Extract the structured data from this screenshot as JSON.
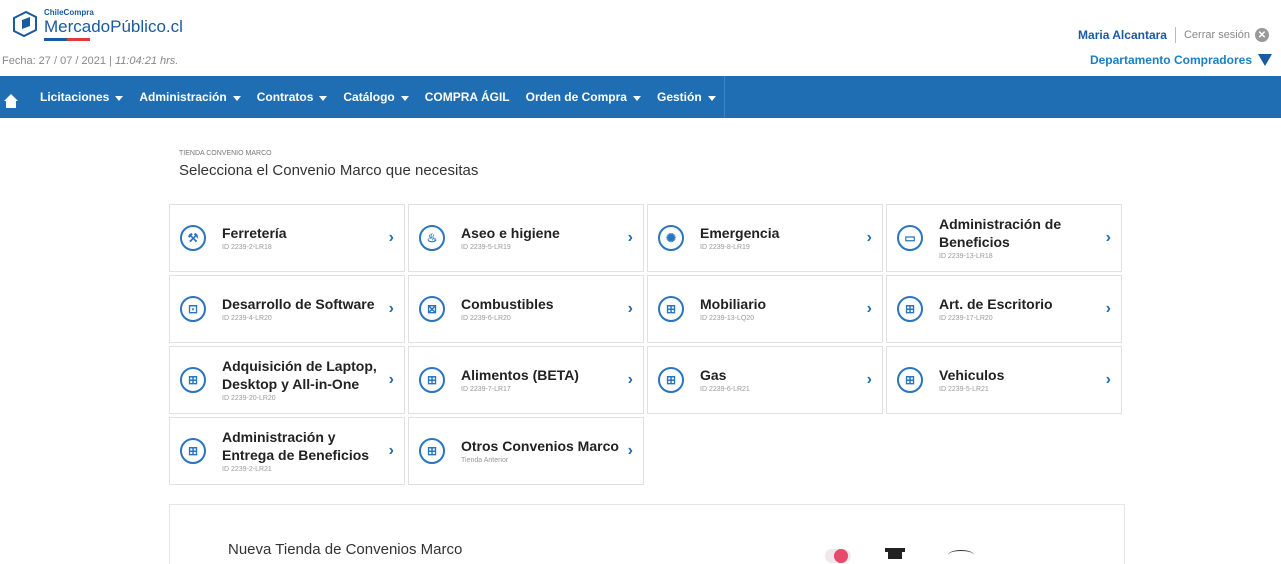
{
  "header": {
    "logo_small": "ChileCompra",
    "logo_big": "MercadoPúblico.cl",
    "date_label": "Fecha: 27 / 07 / 2021 | ",
    "time": "11:04:21 hrs.",
    "user_name": "Maria Alcantara",
    "logout_label": "Cerrar sesión",
    "department": "Departamento Compradores"
  },
  "nav": {
    "items": [
      {
        "label": "Licitaciones",
        "dropdown": true
      },
      {
        "label": "Administración",
        "dropdown": true
      },
      {
        "label": "Contratos",
        "dropdown": true
      },
      {
        "label": "Catálogo",
        "dropdown": true
      },
      {
        "label": "COMPRA ÁGIL",
        "dropdown": false
      },
      {
        "label": "Orden de Compra",
        "dropdown": true
      },
      {
        "label": "Gestión",
        "dropdown": true
      }
    ]
  },
  "main": {
    "kicker": "TIENDA CONVENIO MARCO",
    "title": "Selecciona el Convenio Marco que necesitas",
    "cards": [
      {
        "name": "Ferretería",
        "id": "ID 2239-2-LR18",
        "icon": "tool-icon"
      },
      {
        "name": "Aseo e higiene",
        "id": "ID 2239-5-LR19",
        "icon": "cleaning-icon"
      },
      {
        "name": "Emergencia",
        "id": "ID 2239-8-LR19",
        "icon": "siren-icon"
      },
      {
        "name": "Administración de Beneficios",
        "id": "ID 2239-13-LR18",
        "icon": "card-icon"
      },
      {
        "name": "Desarrollo de Software",
        "id": "ID 2239-4-LR20",
        "icon": "software-icon"
      },
      {
        "name": "Combustibles",
        "id": "ID 2239-6-LR20",
        "icon": "fuel-icon"
      },
      {
        "name": "Mobiliario",
        "id": "ID 2239-13-LQ20",
        "icon": "cart-icon"
      },
      {
        "name": "Art. de Escritorio",
        "id": "ID 2239-17-LR20",
        "icon": "cart-icon"
      },
      {
        "name": "Adquisición de Laptop, Desktop y All-in-One",
        "id": "ID 2239-20-LR20",
        "icon": "cart-icon"
      },
      {
        "name": "Alimentos (BETA)",
        "id": "ID 2239-7-LR17",
        "icon": "cart-icon"
      },
      {
        "name": "Gas",
        "id": "ID 2239-6-LR21",
        "icon": "cart-icon"
      },
      {
        "name": "Vehiculos",
        "id": "ID 2239-5-LR21",
        "icon": "cart-icon"
      },
      {
        "name": "Administración y Entrega de Beneficios",
        "id": "ID 2239-2-LR21",
        "icon": "cart-icon"
      },
      {
        "name": "Otros Convenios Marco",
        "id": "Tienda Anterior",
        "icon": "cart-icon"
      }
    ]
  },
  "banner": {
    "text": "Nueva Tienda de Convenios Marco"
  },
  "colors": {
    "brand": "#1f6db3",
    "accent": "#1a7fc4"
  }
}
